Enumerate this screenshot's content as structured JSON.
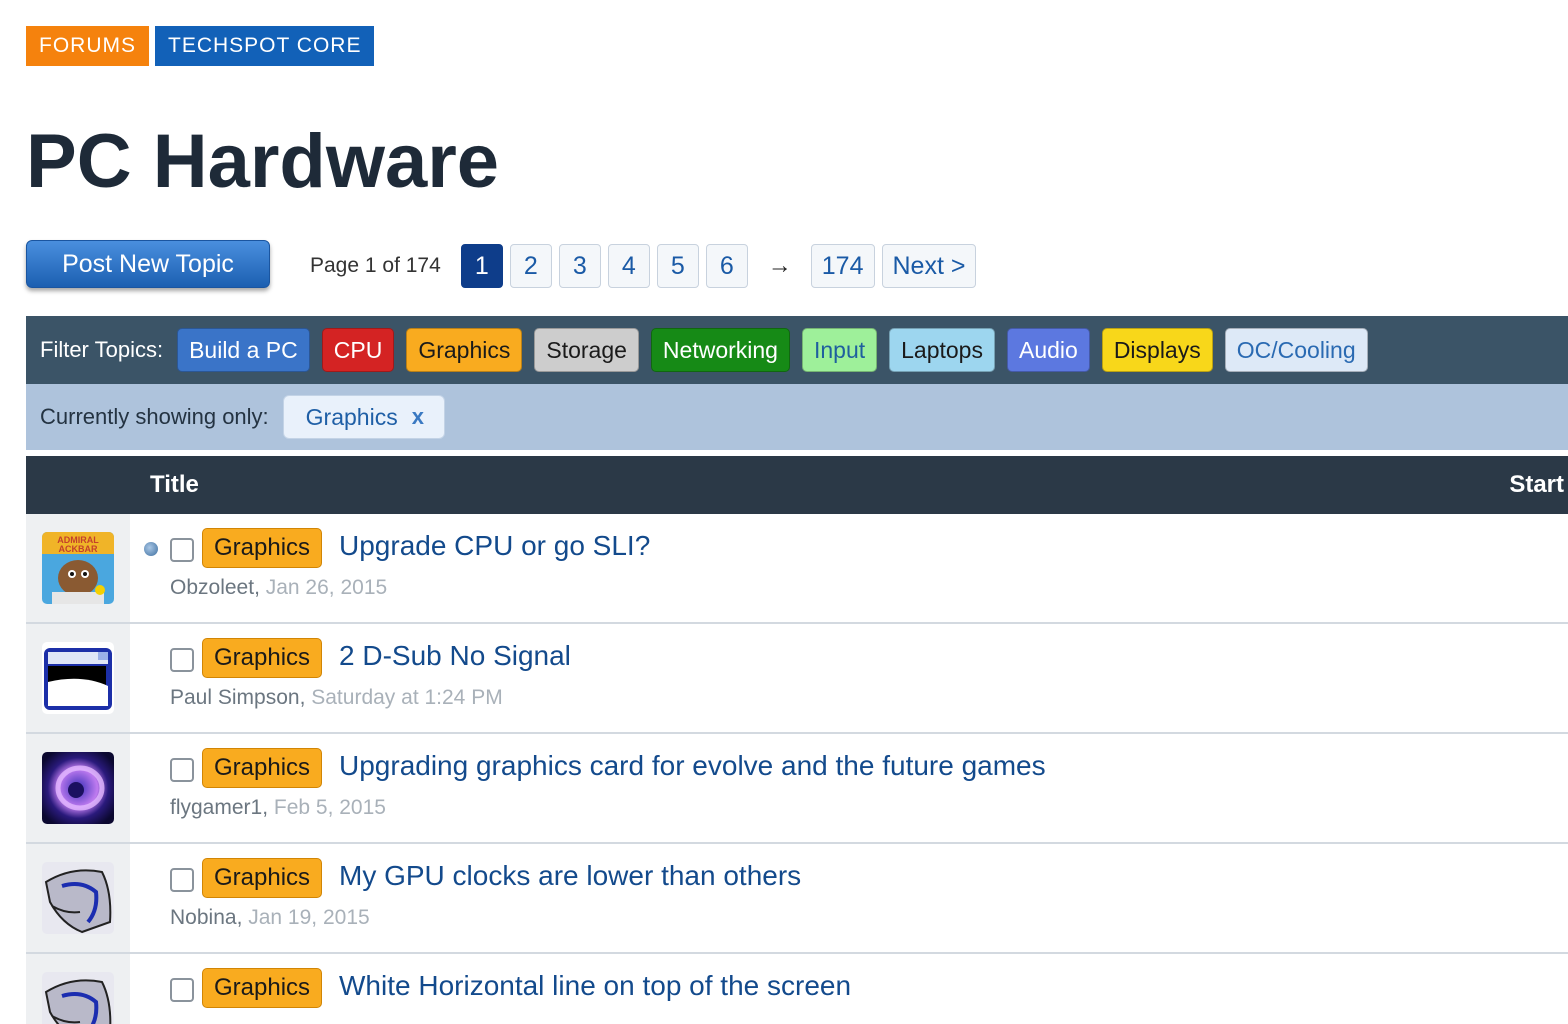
{
  "breadcrumbs": [
    "FORUMS",
    "TECHSPOT CORE"
  ],
  "page_title": "PC Hardware",
  "post_button": "Post New Topic",
  "pagination": {
    "info": "Page 1 of 174",
    "pages": [
      "1",
      "2",
      "3",
      "4",
      "5",
      "6"
    ],
    "current": "1",
    "arrow": "→",
    "last": "174",
    "next": "Next >"
  },
  "filters": {
    "label": "Filter Topics:",
    "tags": [
      {
        "label": "Build a PC",
        "bg": "#3a74c8",
        "fg": "#ffffff"
      },
      {
        "label": "CPU",
        "bg": "#d42323",
        "fg": "#ffffff"
      },
      {
        "label": "Graphics",
        "bg": "#f9ab1f",
        "fg": "#1a1a1a"
      },
      {
        "label": "Storage",
        "bg": "#cdcdcd",
        "fg": "#1a1a1a"
      },
      {
        "label": "Networking",
        "bg": "#168a16",
        "fg": "#ffffff"
      },
      {
        "label": "Input",
        "bg": "#9ef09a",
        "fg": "#1f5f9e"
      },
      {
        "label": "Laptops",
        "bg": "#9dd6ef",
        "fg": "#1a1a1a"
      },
      {
        "label": "Audio",
        "bg": "#5c78e0",
        "fg": "#ffffff"
      },
      {
        "label": "Displays",
        "bg": "#f8d71a",
        "fg": "#1a1a1a"
      },
      {
        "label": "OC/Cooling",
        "bg": "#dde9f7",
        "fg": "#2a6ab2"
      }
    ]
  },
  "showing": {
    "label": "Currently showing only:",
    "value": "Graphics",
    "remove": "x"
  },
  "table": {
    "columns": [
      "Title",
      "Start"
    ],
    "rows": [
      {
        "tag": "Graphics",
        "title": "Upgrade CPU or go SLI?",
        "author": "Obzoleet",
        "date": "Jan 26, 2015",
        "unread": true,
        "avatar": "admiral-ackbar-avatar"
      },
      {
        "tag": "Graphics",
        "title": "2 D-Sub No Signal",
        "author": "Paul Simpson",
        "date": "Saturday at 1:24 PM",
        "unread": false,
        "avatar": "blue-window-avatar"
      },
      {
        "tag": "Graphics",
        "title": "Upgrading graphics card for evolve and the future games",
        "author": "flygamer1",
        "date": "Feb 5, 2015",
        "unread": false,
        "avatar": "purple-orb-avatar"
      },
      {
        "tag": "Graphics",
        "title": "My GPU clocks are lower than others",
        "author": "Nobina",
        "date": "Jan 19, 2015",
        "unread": false,
        "avatar": "sketch-avatar"
      },
      {
        "tag": "Graphics",
        "title": "White Horizontal line on top of the screen",
        "author": "",
        "date": "",
        "unread": false,
        "avatar": "sketch-avatar"
      }
    ]
  }
}
